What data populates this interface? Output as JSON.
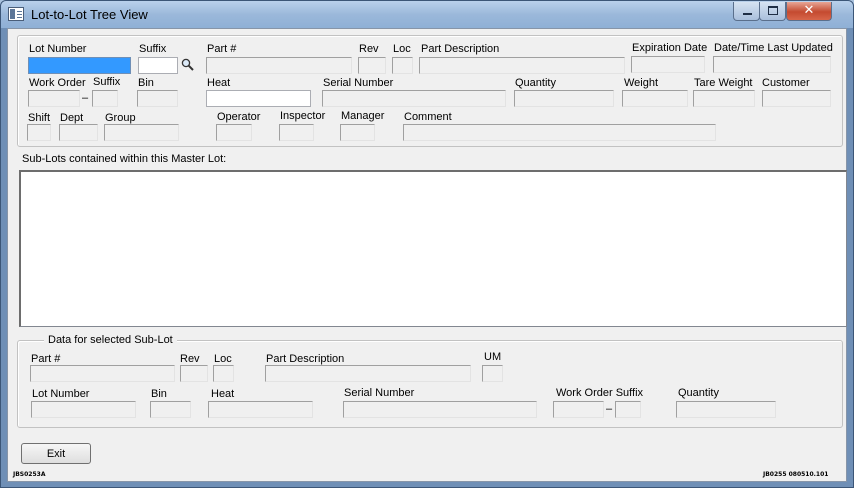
{
  "window": {
    "title": "Lot-to-Lot Tree View",
    "close_glyph": "✕"
  },
  "master": {
    "lot_number": "Lot Number",
    "suffix": "Suffix",
    "part_no": "Part #",
    "rev": "Rev",
    "loc": "Loc",
    "part_description": "Part Description",
    "expiration_date": "Expiration Date",
    "date_time_last_updated": "Date/Time Last Updated",
    "work_order": "Work Order",
    "wo_suffix": "Suffix",
    "bin": "Bin",
    "heat": "Heat",
    "serial_number": "Serial Number",
    "quantity": "Quantity",
    "weight": "Weight",
    "tare_weight": "Tare Weight",
    "customer": "Customer",
    "shift": "Shift",
    "dept": "Dept",
    "group": "Group",
    "operator": "Operator",
    "inspector": "Inspector",
    "manager": "Manager",
    "comment": "Comment",
    "dash": "–"
  },
  "sublots": {
    "label": "Sub-Lots contained within this Master Lot:"
  },
  "selected": {
    "title": "Data for selected Sub-Lot",
    "part_no": "Part #",
    "rev": "Rev",
    "loc": "Loc",
    "part_description": "Part Description",
    "um": "UM",
    "lot_number": "Lot Number",
    "bin": "Bin",
    "heat": "Heat",
    "serial_number": "Serial Number",
    "work_order_suffix": "Work Order Suffix",
    "quantity": "Quantity",
    "dash": "–"
  },
  "footer": {
    "exit_label": "Exit",
    "left_code": "JBS0253A",
    "right_code": "JB0255 080510.101"
  },
  "icons": {
    "search": "search-icon"
  }
}
